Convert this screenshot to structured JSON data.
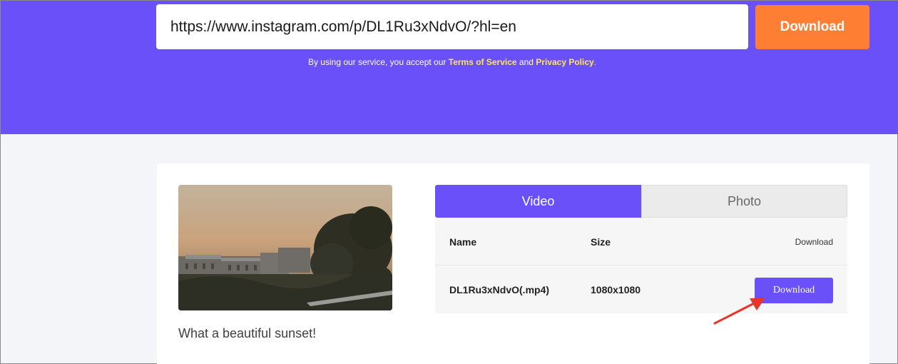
{
  "search": {
    "url_value": "https://www.instagram.com/p/DL1Ru3xNdvO/?hl=en",
    "download_label": "Download"
  },
  "terms": {
    "prefix": "By using our service, you accept our",
    "tos_label": "Terms of Service",
    "and": "and",
    "privacy_label": "Privacy Policy",
    "suffix": "."
  },
  "result": {
    "caption": "What a beautiful sunset!",
    "tabs": [
      {
        "label": "Video",
        "active": true
      },
      {
        "label": "Photo",
        "active": false
      }
    ],
    "table": {
      "headers": {
        "name": "Name",
        "size": "Size",
        "download": "Download"
      },
      "rows": [
        {
          "name": "DL1Ru3xNdvO(.mp4)",
          "size": "1080x1080",
          "button_label": "Download"
        }
      ]
    }
  },
  "colors": {
    "brand_purple": "#6a50f8",
    "cta_orange": "#fe7f33",
    "link_yellow": "#ffe94a",
    "annotation_red": "#e8342a"
  },
  "icons": {
    "annotation": "red-arrow-icon"
  }
}
